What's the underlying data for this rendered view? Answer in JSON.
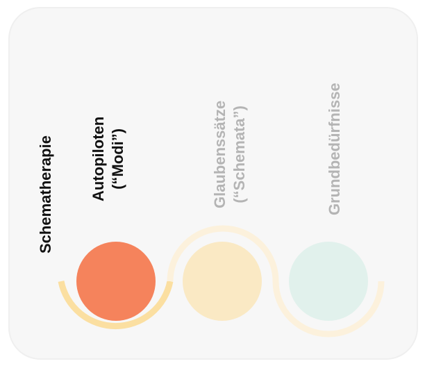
{
  "title": "Schematherapie",
  "items": [
    {
      "line1": "Autopiloten",
      "line2": "(“Modi”)",
      "active": true,
      "color": "#f5835c"
    },
    {
      "line1": "Glaubenssätze",
      "line2": "(“Schemata”)",
      "active": false,
      "color": "#fae9c4"
    },
    {
      "line1": "Grundbedürfnisse",
      "line2": "",
      "active": false,
      "color": "#e1f1ec"
    }
  ],
  "colors": {
    "active_text": "#111111",
    "inactive_text": "#b4b4b4",
    "active_arc": "#fbdfa1",
    "inactive_arc": "#fcf1dc",
    "card_background": "#f7f7f7"
  }
}
